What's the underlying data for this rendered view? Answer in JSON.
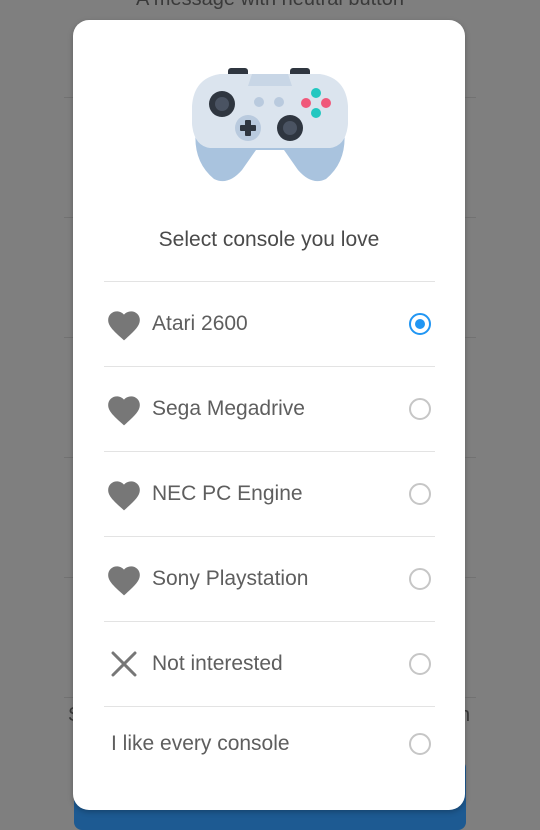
{
  "background": {
    "top_message": "A message with neutral button",
    "partial_left_char": "S",
    "partial_right_char": "n"
  },
  "dialog": {
    "title": "Select console you love",
    "illustration": "gamepad-icon",
    "options": [
      {
        "label": "Atari 2600",
        "icon": "heart-icon",
        "selected": true
      },
      {
        "label": "Sega Megadrive",
        "icon": "heart-icon",
        "selected": false
      },
      {
        "label": "NEC PC Engine",
        "icon": "heart-icon",
        "selected": false
      },
      {
        "label": "Sony Playstation",
        "icon": "heart-icon",
        "selected": false
      },
      {
        "label": "Not interested",
        "icon": "close-icon",
        "selected": false
      },
      {
        "label": "I like every console",
        "icon": "",
        "selected": false
      }
    ]
  },
  "colors": {
    "accent": "#2196f3",
    "scrim": "#7f7f7f",
    "background_button": "#1d5a92"
  }
}
